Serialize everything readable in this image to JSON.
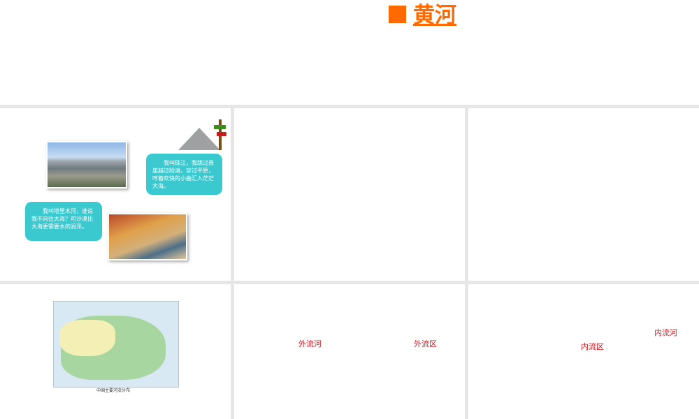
{
  "header": {
    "title": "黄河"
  },
  "slide1": {
    "bubble_pearl": "我叫珠江，我跳过悬崖越过险滩，穿过平原，哼着欢快的小曲汇入茫茫大海。",
    "bubble_tarim": "我叫塔里木河，谁说我不向往大海？可沙漠比大海更需要水的润泽。"
  },
  "slide4": {
    "map_caption": "中国主要河流分布"
  },
  "slide5": {
    "label_outflow_river": "外流河",
    "label_outflow_area": "外流区"
  },
  "slide6": {
    "label_inland_river": "内流河",
    "label_inland_area": "内流区"
  },
  "colors": {
    "title": "#ff6a00",
    "bubble": "#3ac9cf",
    "label": "#d0141a"
  }
}
